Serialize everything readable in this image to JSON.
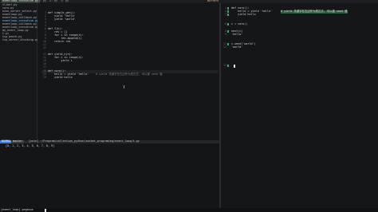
{
  "tabs": {
    "left": [
      "eventloop_coroutine.py",
      "1: py",
      "2: py",
      "3: py"
    ],
    "right": "buffers"
  },
  "sidebar": {
    "files": [
      "client.py",
      "coro.py",
      "echo_server_select.py",
      "eventloop.py",
      "eventloop_callback.py",
      "eventloop_coroutine.py",
      "eventloop_callback.py",
      "eventloop_coroutine.py",
      "my_event_loop.py",
      "t.py",
      "tcp_bench.py",
      "tcp_server_blocking.py"
    ]
  },
  "editor": {
    "lines": [
      {
        "n": "1",
        "text": "def simple_gen():"
      },
      {
        "n": "2",
        "text": "    yield 'hello'"
      },
      {
        "n": "3",
        "text": "    yield 'world'"
      },
      {
        "n": "4",
        "text": ""
      },
      {
        "n": "5",
        "text": ""
      },
      {
        "n": "6",
        "text": "def f(n):"
      },
      {
        "n": "7",
        "text": "    res = []"
      },
      {
        "n": "8",
        "text": "    for i in range(n):"
      },
      {
        "n": "9",
        "text": "        res.append(i)"
      },
      {
        "n": "10",
        "text": "    return res"
      },
      {
        "n": "11",
        "text": ""
      },
      {
        "n": "12",
        "text": ""
      },
      {
        "n": "13",
        "text": "def yield_n(n):"
      },
      {
        "n": "14",
        "text": "    for i in range(n):"
      },
      {
        "n": "15",
        "text": "        yield i"
      },
      {
        "n": "16",
        "text": ""
      },
      {
        "n": "17",
        "text": ""
      },
      {
        "n": "18",
        "text": "def coro():"
      },
      {
        "n": "19",
        "text": "    hello = yield 'hello'"
      },
      {
        "n": "20",
        "text": "    yield hello"
      }
    ],
    "comment": "# yield 关键字在右边作为表达式, 可以被 send 值"
  },
  "statusbar": {
    "mode": "NORMAL",
    "branch": "master",
    "path": "[unix] ~/Program/collection_python/socket_programing/event_loop/t.py"
  },
  "output": {
    "line": "[0, 1, 2, 3, 4, 5, 6, 7, 8, 9]"
  },
  "repl": {
    "lines": [
      {
        "n": "1",
        "text": "def coro():"
      },
      {
        "n": "2",
        "text": "    hello = yield 'hello'"
      },
      {
        "n": "3",
        "text": "    yield hello"
      },
      {
        "n": "4",
        "text": ""
      },
      {
        "n": "5",
        "text": ""
      },
      {
        "n": "6",
        "text": "c = coro()"
      },
      {
        "n": "7",
        "text": ""
      },
      {
        "n": "8",
        "text": "next(c)"
      },
      {
        "n": "9",
        "text": "'hello'"
      },
      {
        "n": "10",
        "text": ""
      },
      {
        "n": "11",
        "text": "c.send('world')"
      },
      {
        "n": "12",
        "text": "'world'"
      },
      {
        "n": "13",
        "text": ""
      }
    ],
    "highlight": "# yield 关键字在右边作为表达式, 可以被 send 值"
  },
  "tmux": {
    "session": "[event_loop] pegasus"
  }
}
